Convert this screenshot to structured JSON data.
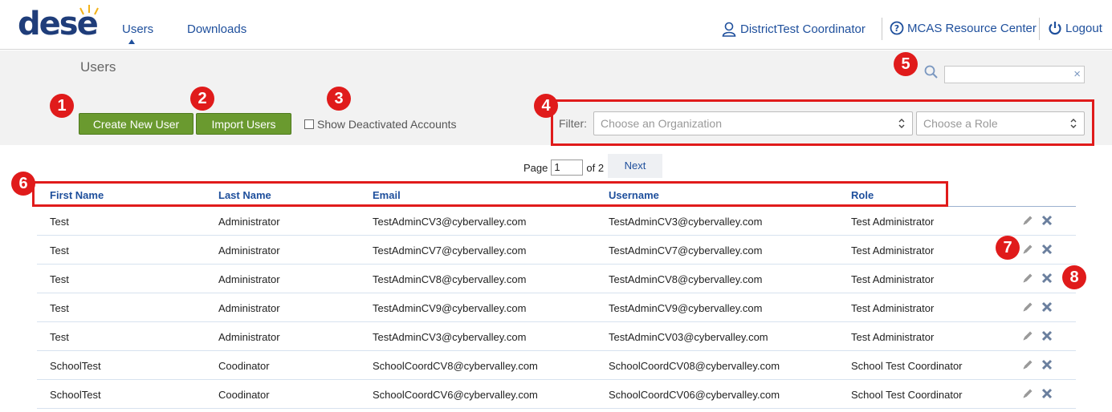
{
  "header": {
    "logo": "dese",
    "nav": {
      "users": "Users",
      "downloads": "Downloads"
    },
    "user_name": "DistrictTest Coordinator",
    "resource_center": "MCAS Resource Center",
    "logout": "Logout"
  },
  "page": {
    "title": "Users"
  },
  "search": {
    "value": "",
    "clear": "×"
  },
  "toolbar": {
    "create_label": "Create New User",
    "import_label": "Import Users",
    "show_deactivated": "Show Deactivated Accounts",
    "filter_label": "Filter:",
    "org_placeholder": "Choose an Organization",
    "role_placeholder": "Choose a Role"
  },
  "pagination": {
    "page_label": "Page",
    "current": "1",
    "of_label": "of 2",
    "next": "Next"
  },
  "table": {
    "columns": [
      "First Name",
      "Last Name",
      "Email",
      "Username",
      "Role"
    ],
    "rows": [
      [
        "Test",
        "Administrator",
        "TestAdminCV3@cybervalley.com",
        "TestAdminCV3@cybervalley.com",
        "Test Administrator"
      ],
      [
        "Test",
        "Administrator",
        "TestAdminCV7@cybervalley.com",
        "TestAdminCV7@cybervalley.com",
        "Test Administrator"
      ],
      [
        "Test",
        "Administrator",
        "TestAdminCV8@cybervalley.com",
        "TestAdminCV8@cybervalley.com",
        "Test Administrator"
      ],
      [
        "Test",
        "Administrator",
        "TestAdminCV9@cybervalley.com",
        "TestAdminCV9@cybervalley.com",
        "Test Administrator"
      ],
      [
        "Test",
        "Administrator",
        "TestAdminCV3@cybervalley.com",
        "TestAdminCV03@cybervalley.com",
        "Test Administrator"
      ],
      [
        "SchoolTest",
        "Coodinator",
        "SchoolCoordCV8@cybervalley.com",
        "SchoolCoordCV08@cybervalley.com",
        "School Test Coordinator"
      ],
      [
        "SchoolTest",
        "Coodinator",
        "SchoolCoordCV6@cybervalley.com",
        "SchoolCoordCV06@cybervalley.com",
        "School Test Coordinator"
      ]
    ]
  },
  "callouts": [
    "1",
    "2",
    "3",
    "4",
    "5",
    "6",
    "7",
    "8"
  ],
  "colors": {
    "brand": "#1f3d7a",
    "link": "#1e4f9c",
    "button_green": "#6a9a2f",
    "callout_red": "#e01b1b"
  },
  "icons": [
    "user-icon",
    "question-circle-icon",
    "power-icon",
    "search-icon",
    "clear-icon",
    "select-arrows-icon",
    "edit-pencil-icon",
    "delete-x-icon"
  ]
}
